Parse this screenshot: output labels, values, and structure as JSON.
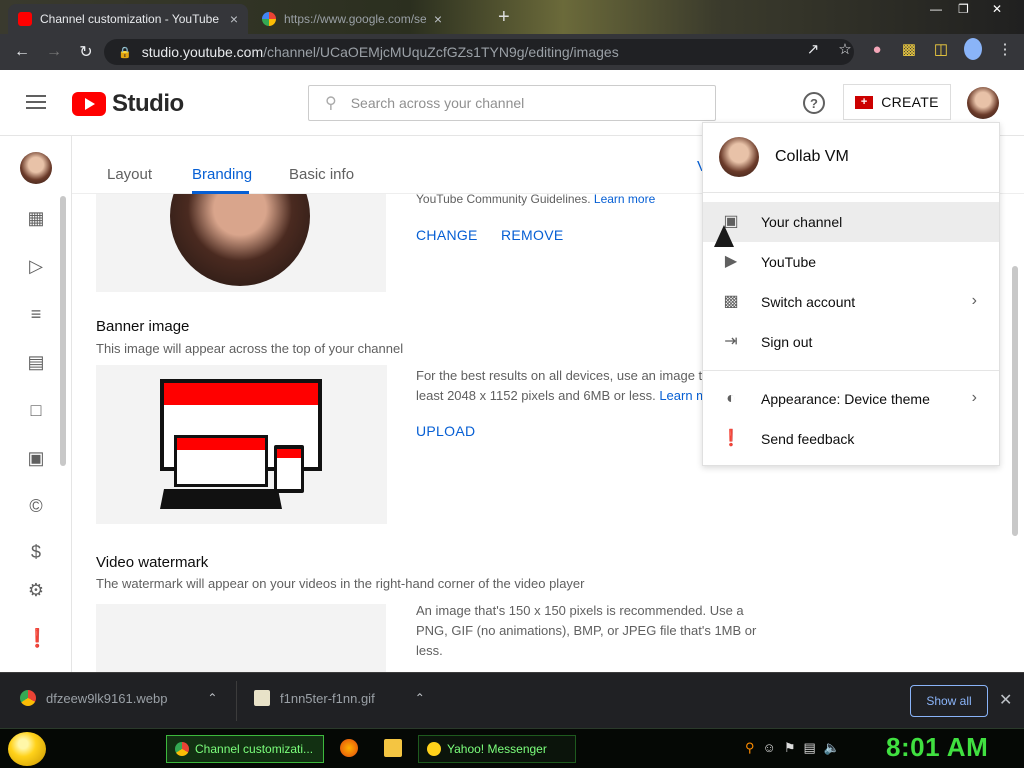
{
  "browser": {
    "tabs": [
      {
        "title": "Channel customization - YouTube",
        "close": "×"
      },
      {
        "title": "https://www.google.com/search",
        "close": "×"
      }
    ],
    "new_tab": "+",
    "url_host": "studio.youtube.com",
    "url_path": "/channel/UCaOEMjcMUquZcfGZs1TYN9g/editing/images"
  },
  "header": {
    "logo_text": "Studio",
    "search_placeholder": "Search across your channel",
    "help": "?",
    "create_label": "CREATE"
  },
  "tabs": [
    "Layout",
    "Branding",
    "Basic info"
  ],
  "tabs_cut": "V",
  "picture": {
    "guideline": "YouTube Community Guidelines.",
    "learn_more": "Learn more",
    "change": "CHANGE",
    "remove": "REMOVE"
  },
  "banner": {
    "title": "Banner image",
    "desc": "This image will appear across the top of your channel",
    "info_line1": "For the best results on all devices, use an image th",
    "info_line2": "least 2048 x 1152 pixels and 6MB or less.",
    "learn_more": "Learn m",
    "upload": "UPLOAD"
  },
  "watermark": {
    "title": "Video watermark",
    "desc": "The watermark will appear on your videos in the right-hand corner of the video player",
    "info_line1": "An image that's 150 x 150 pixels is recommended. Use a",
    "info_line2": "PNG, GIF (no animations), BMP, or JPEG file that's 1MB or",
    "info_line3": "less."
  },
  "account_menu": {
    "name": "Collab VM",
    "items": [
      {
        "label": "Your channel",
        "icon": "person-box-icon"
      },
      {
        "label": "YouTube",
        "icon": "youtube-icon"
      },
      {
        "label": "Switch account",
        "icon": "switch-account-icon"
      },
      {
        "label": "Sign out",
        "icon": "sign-out-icon"
      },
      {
        "label": "Appearance: Device theme",
        "icon": "appearance-icon"
      },
      {
        "label": "Send feedback",
        "icon": "feedback-icon"
      }
    ]
  },
  "downloads": {
    "file1": "dfzeew9lk9161.webp",
    "file2": "f1nn5ter-f1nn.gif",
    "show_all": "Show all"
  },
  "taskbar": {
    "task1": "Channel customizati...",
    "task2": "Yahoo! Messenger",
    "clock": "8:01 AM"
  },
  "colors": {
    "youtube_red": "#ff0000",
    "link_blue": "#065fd4",
    "clock_green": "#40e040"
  }
}
